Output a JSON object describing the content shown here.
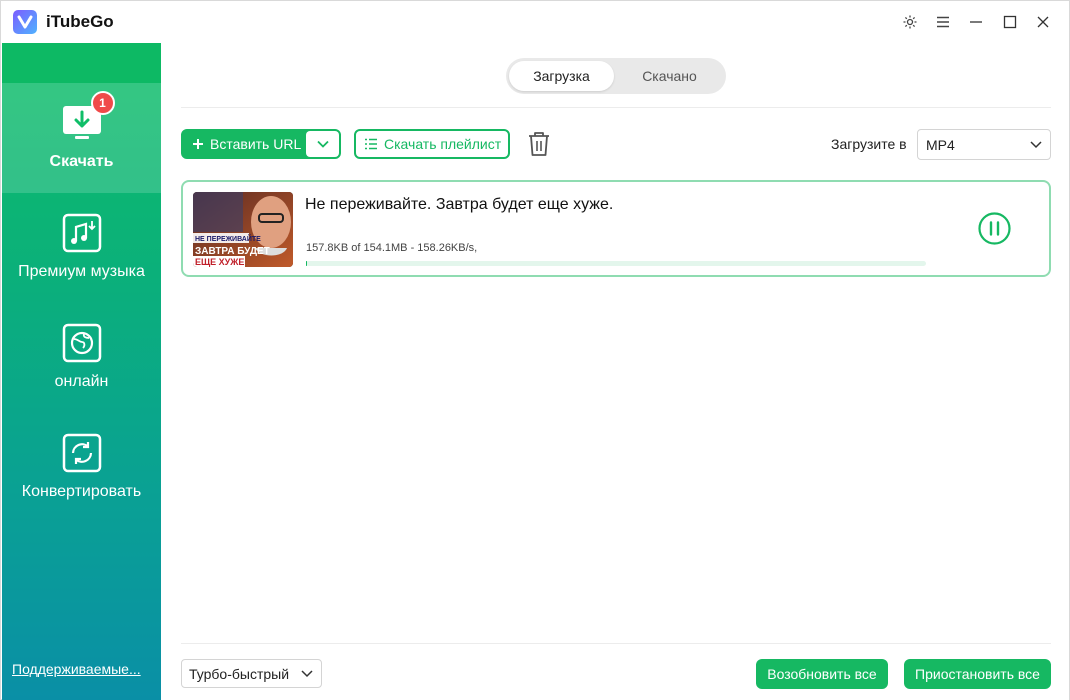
{
  "app": {
    "title": "iTubeGo"
  },
  "window_controls": [
    "gear-icon",
    "menu-icon",
    "minimize-icon",
    "maximize-icon",
    "close-icon"
  ],
  "colors": {
    "accent": "#16b862",
    "badge": "#f04a4a",
    "sidebar_top": "#0fbe68",
    "sidebar_bottom": "#0a8fa6"
  },
  "sidebar": {
    "items": [
      {
        "label": "Скачать",
        "icon": "download-icon",
        "active": true,
        "badge": "1"
      },
      {
        "label": "Премиум музыка",
        "icon": "music-icon",
        "active": false
      },
      {
        "label": "онлайн",
        "icon": "globe-icon",
        "active": false
      },
      {
        "label": "Конвертировать",
        "icon": "convert-icon",
        "active": false
      }
    ],
    "supported_link": "Поддерживаемые..."
  },
  "tabs": [
    {
      "label": "Загрузка",
      "active": true
    },
    {
      "label": "Скачано",
      "active": false
    }
  ],
  "toolbar": {
    "paste_url": "Вставить URL",
    "playlist": "Скачать плейлист",
    "save_label": "Загрузите в",
    "format": "MP4"
  },
  "downloads": [
    {
      "title": "Не переживайте. Завтра будет еще хуже.",
      "status": "157.8KB of 154.1MB -  158.26KB/s,",
      "progress": 0.001,
      "thumbnail_text": [
        "НЕ ПЕРЕЖИВАЙТЕ",
        "ЗАВТРА БУДЕТ",
        "ЕЩЕ ХУЖЕ"
      ]
    }
  ],
  "footer": {
    "speed": "Турбо-быстрый",
    "resume_all": "Возобновить все",
    "pause_all": "Приостановить все"
  }
}
